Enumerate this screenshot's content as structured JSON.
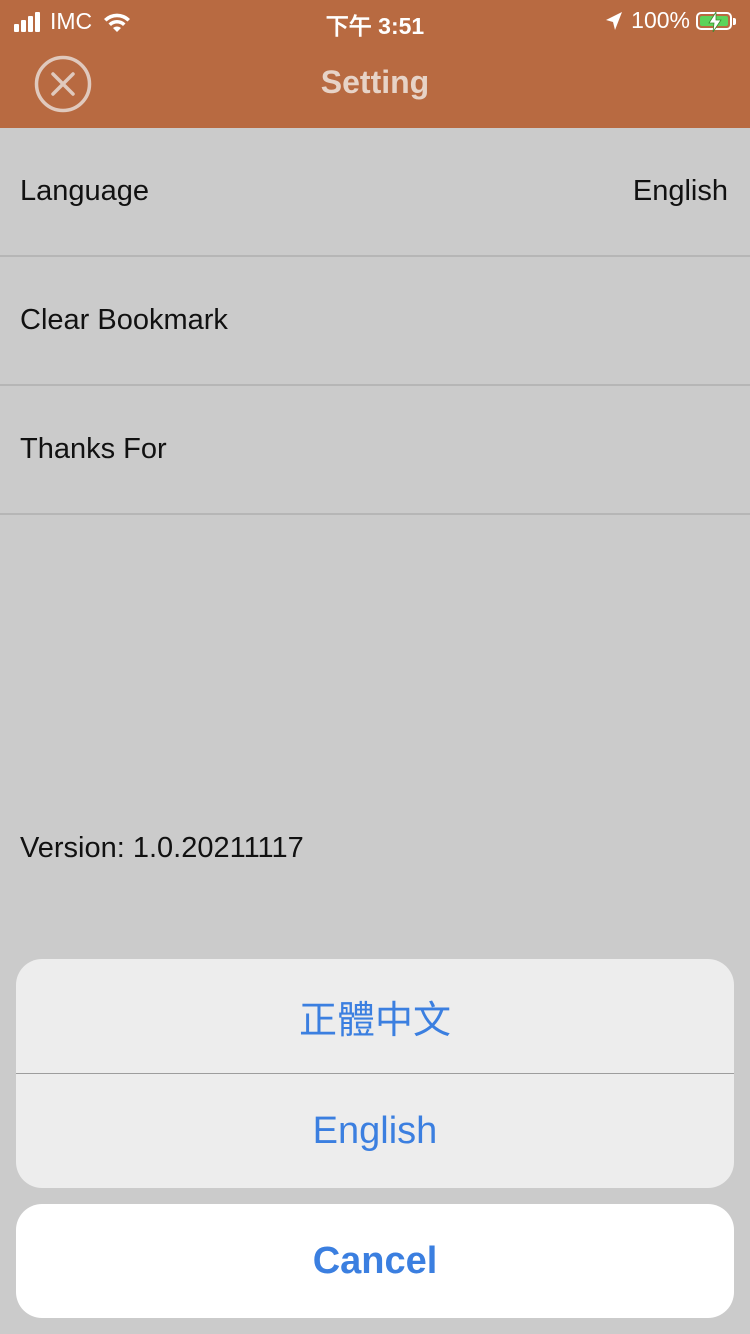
{
  "status_bar": {
    "carrier": "IMC",
    "time": "下午 3:51",
    "battery_percent": "100%",
    "battery_level": 1.0,
    "signal_bars": 4
  },
  "header": {
    "title": "Setting",
    "close_icon": "close-circle-icon",
    "background_color": "#b86a41"
  },
  "settings": {
    "items": [
      {
        "label": "Language",
        "value": "English"
      },
      {
        "label": "Clear Bookmark",
        "value": ""
      },
      {
        "label": "Thanks For",
        "value": ""
      }
    ]
  },
  "footer": {
    "version": "Version: 1.0.20211117"
  },
  "action_sheet": {
    "options": [
      "正體中文",
      "English"
    ],
    "cancel_label": "Cancel",
    "accent_color": "#3b7fe0"
  }
}
